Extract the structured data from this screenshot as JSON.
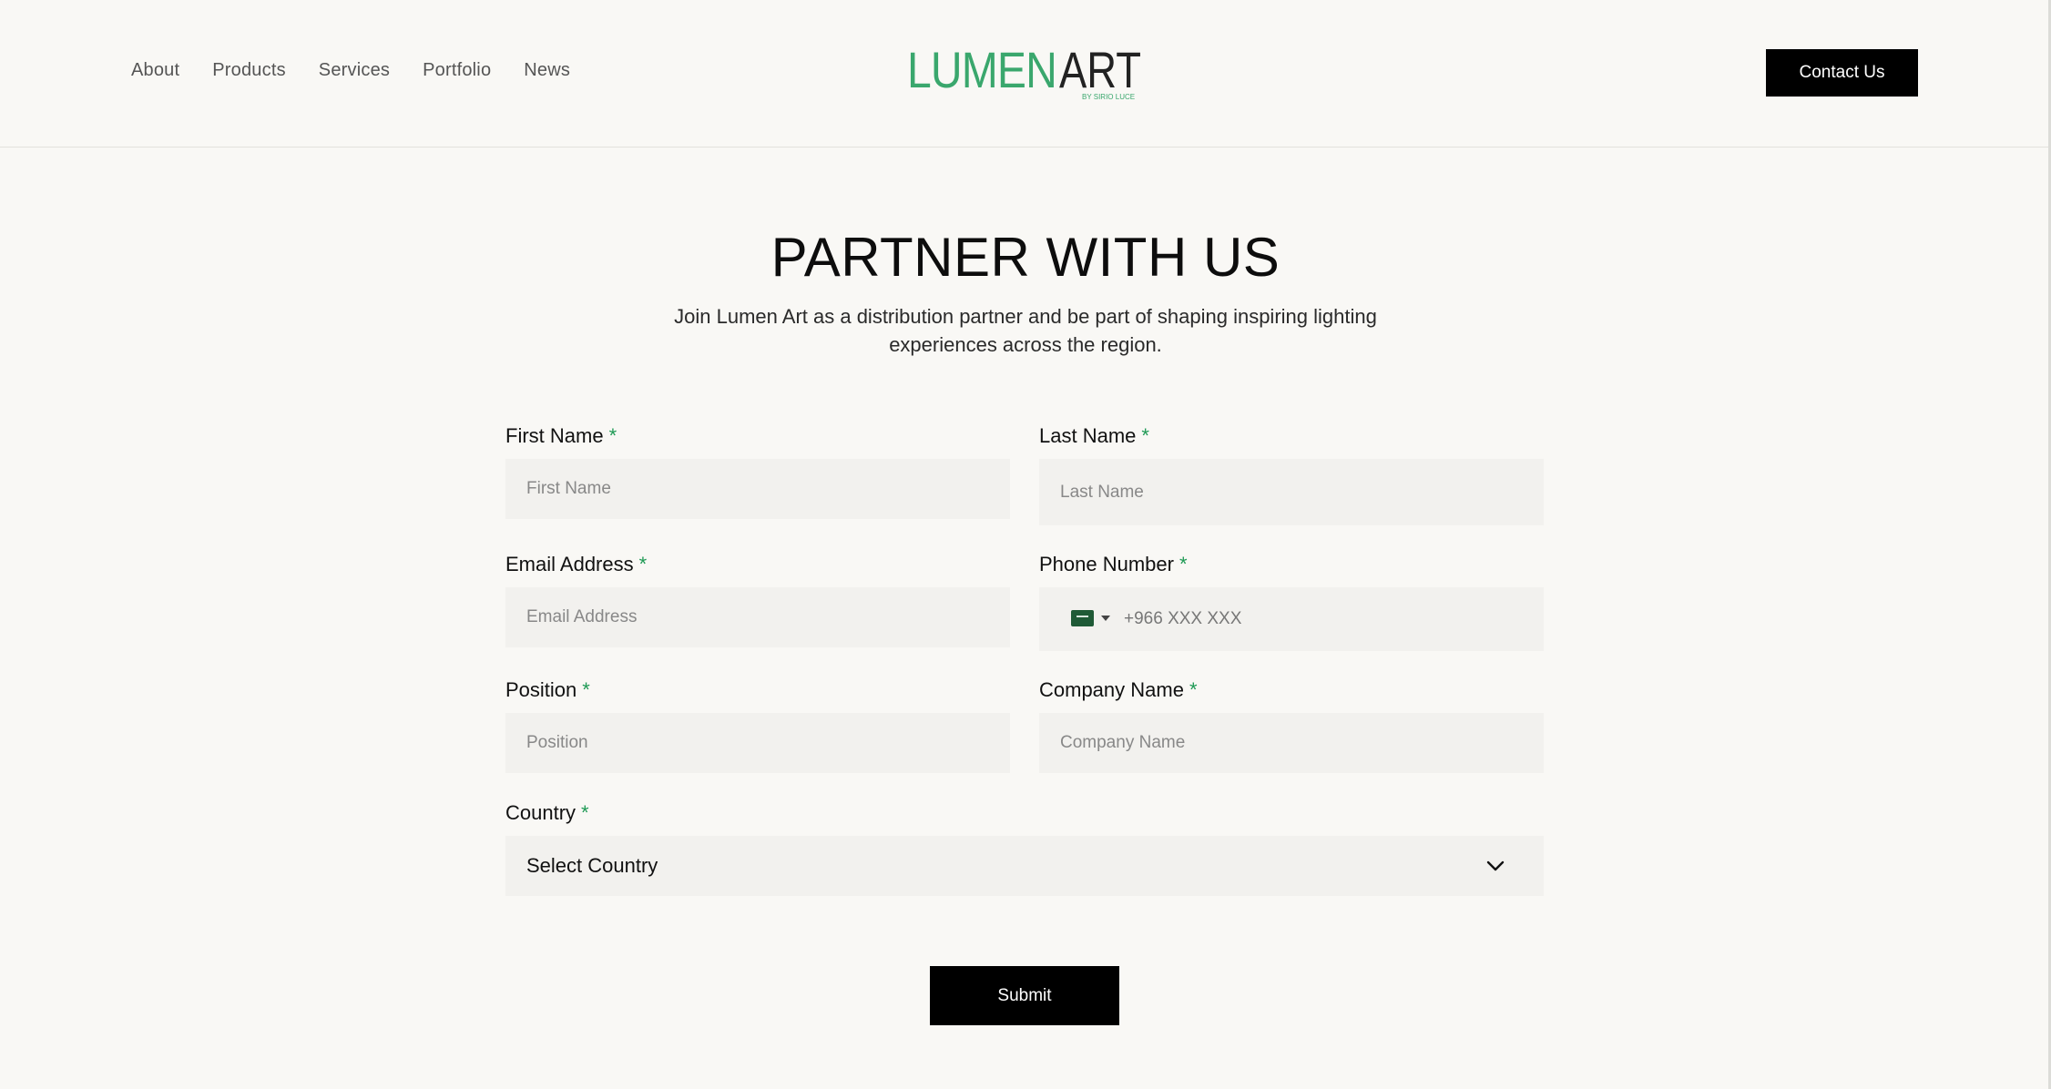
{
  "nav": {
    "items": [
      {
        "label": "About"
      },
      {
        "label": "Products"
      },
      {
        "label": "Services"
      },
      {
        "label": "Portfolio"
      },
      {
        "label": "News"
      }
    ]
  },
  "logo": {
    "word_left": "LUMEN",
    "word_right": "ART",
    "tagline": "BY SIRIO LUCE",
    "color_left": "#3aa76d",
    "color_right": "#222222"
  },
  "header": {
    "contact_label": "Contact Us"
  },
  "main": {
    "title": "PARTNER WITH US",
    "subtitle_line1": "Join Lumen Art as a distribution partner and be part of shaping inspiring lighting",
    "subtitle_line2": "experiences across the region."
  },
  "form": {
    "required_mark": "*",
    "first_name": {
      "label": "First Name",
      "placeholder": "First Name",
      "value": ""
    },
    "last_name": {
      "label": "Last Name",
      "placeholder": "Last Name",
      "value": ""
    },
    "email": {
      "label": "Email Address",
      "placeholder": "Email Address",
      "value": ""
    },
    "phone": {
      "label": "Phone Number",
      "placeholder": "+966 XXX XXX",
      "value": "",
      "flag_icon": "saudi-flag-icon"
    },
    "position": {
      "label": "Position",
      "placeholder": "Position",
      "value": ""
    },
    "company": {
      "label": "Company Name",
      "placeholder": "Company Name",
      "value": ""
    },
    "country": {
      "label": "Country",
      "selected": "Select Country"
    },
    "submit_label": "Submit"
  },
  "colors": {
    "accent": "#1f9a55",
    "button_bg": "#000000",
    "field_bg": "#f2f1ee",
    "page_bg": "#f9f8f5"
  }
}
